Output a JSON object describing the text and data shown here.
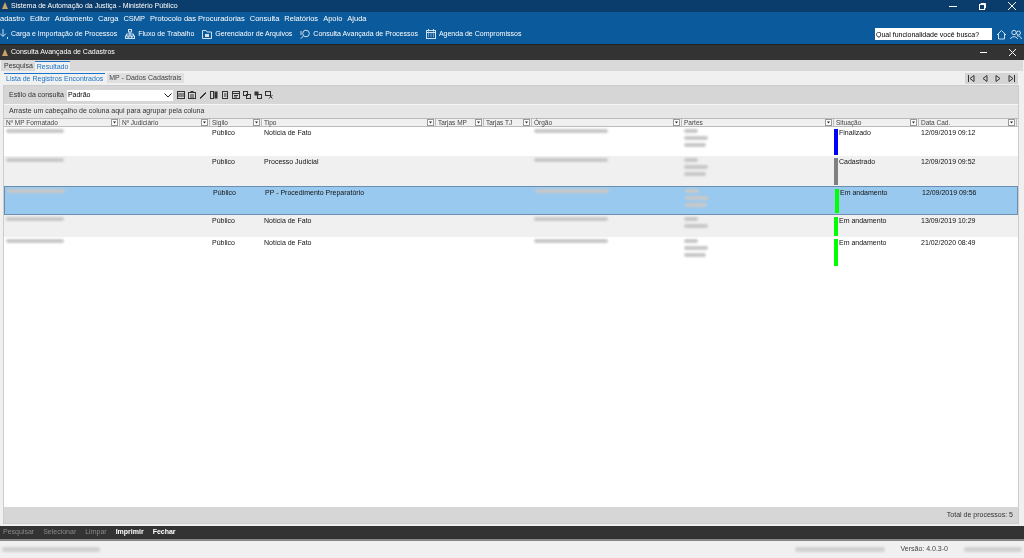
{
  "window": {
    "title": "Sistema de Automação da Justiça - Ministério Público"
  },
  "menu": [
    "adastro",
    "Editor",
    "Andamento",
    "Carga",
    "CSMP",
    "Protocolo das Procuradorias",
    "Consulta",
    "Relatórios",
    "Apoio",
    "Ajuda"
  ],
  "toolbar": [
    {
      "kind": "import",
      "label": "Carga e Importação de Processos"
    },
    {
      "kind": "flow",
      "label": "Fluxo de Trabalho"
    },
    {
      "kind": "files",
      "label": "Gerenciador de Arquivos"
    },
    {
      "kind": "search",
      "label": "Consulta Avançada de Processos"
    },
    {
      "kind": "calendar",
      "label": "Agenda de Compromissos"
    }
  ],
  "search": {
    "placeholder": "Qual funcionalidade você busca?"
  },
  "subwindow": {
    "title": "Consulta Avançada de Cadastros"
  },
  "tabs": [
    {
      "label": "Pesquisa",
      "selected": false
    },
    {
      "label": "Resultado",
      "selected": true
    }
  ],
  "subtabs": [
    {
      "label": "Lista de Registros Encontrados",
      "selected": true
    },
    {
      "label": "MP - Dados Cadastrais",
      "selected": false
    }
  ],
  "query_style": {
    "label": "Estilo da consulta",
    "value": "Padrão"
  },
  "group_hint": "Arraste um cabeçalho de coluna aqui para agrupar pela coluna",
  "table": {
    "columns": [
      "Nº MP Formatado",
      "Nº Judiciário",
      "Sigilo",
      "Tipo",
      "Tarjas MP",
      "Tarjas TJ",
      "Órgão",
      "Partes",
      "Situação",
      "Data Cad."
    ],
    "rows": [
      {
        "sigilo": "Público",
        "tipo": "Notícia de Fato",
        "situacao": "Finalizado",
        "color": "#0000ff",
        "data": "12/09/2019 09:12",
        "selected": false
      },
      {
        "sigilo": "Público",
        "tipo": "Processo Judicial",
        "situacao": "Cadastrado",
        "color": "#808080",
        "data": "12/09/2019 09:52",
        "selected": false
      },
      {
        "sigilo": "Público",
        "tipo": "PP - Procedimento Preparatório",
        "situacao": "Em andamento",
        "color": "#00ff00",
        "data": "12/09/2019 09:56",
        "selected": true
      },
      {
        "sigilo": "Público",
        "tipo": "Notícia de Fato",
        "situacao": "Em andamento",
        "color": "#00ff00",
        "data": "13/09/2019 10:29",
        "selected": false
      },
      {
        "sigilo": "Público",
        "tipo": "Notícia de Fato",
        "situacao": "Em andamento",
        "color": "#00ff00",
        "data": "21/02/2020 08:49",
        "selected": false
      }
    ]
  },
  "total": "Total de processos: 5",
  "actions": [
    {
      "label": "Pesquisar",
      "disabled": true
    },
    {
      "label": "Selecionar",
      "disabled": true
    },
    {
      "label": "Limpar",
      "disabled": true
    },
    {
      "label": "Imprimir",
      "disabled": false
    },
    {
      "label": "Fechar",
      "disabled": false
    }
  ],
  "version": "Versão: 4.0.3-0"
}
